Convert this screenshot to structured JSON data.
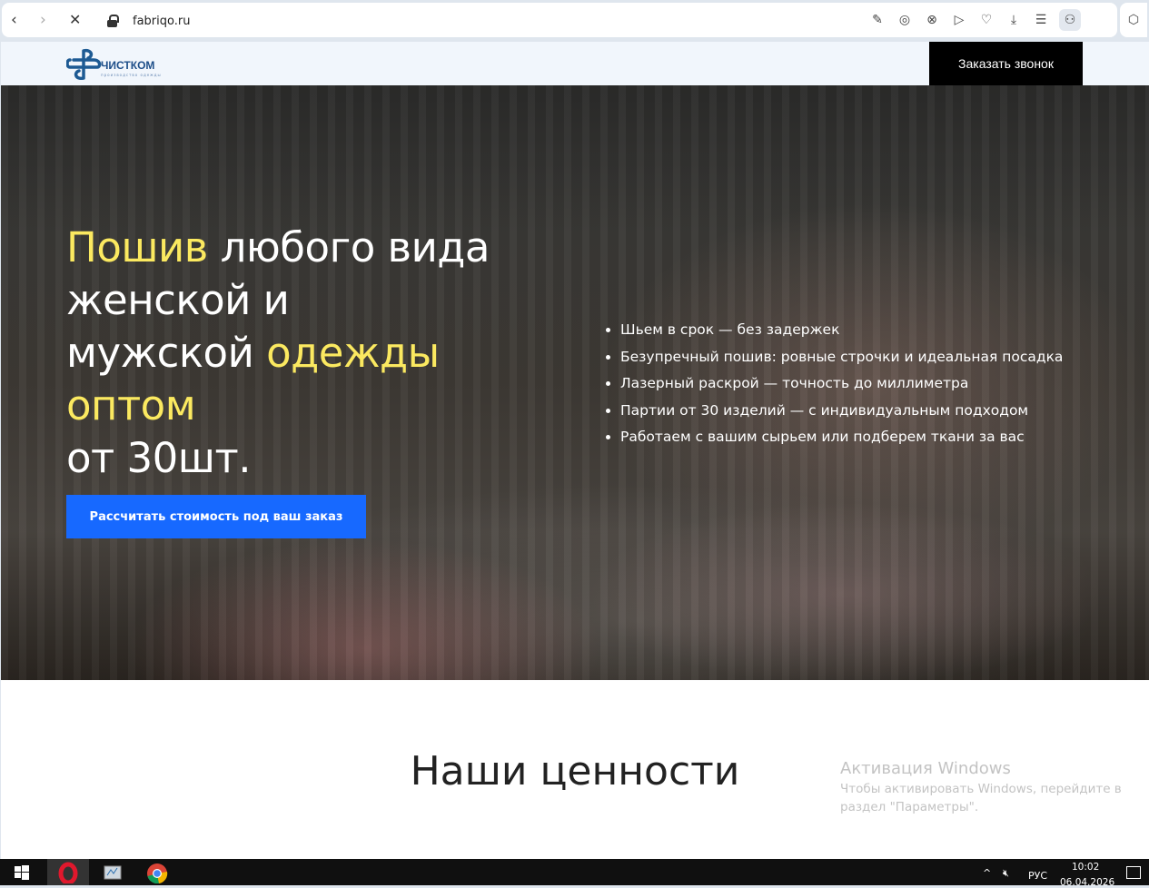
{
  "browser": {
    "url": "fabriqo.ru",
    "back": "‹",
    "forward": "›",
    "stop": "✕",
    "toolbar_icons": [
      "edit-icon",
      "camera-icon",
      "shield-x-icon",
      "send-icon",
      "heart-icon",
      "download-icon",
      "menu-icon",
      "profile-icon"
    ]
  },
  "header": {
    "logo_text": "ЧИСТКОМ",
    "logo_sub": "производство одежды",
    "call_button": "Заказать звонок"
  },
  "hero": {
    "title_parts": [
      "Пошив",
      "любого вида",
      "женской и",
      "мужской",
      "одежды оптом",
      "от 30шт."
    ],
    "bullets": [
      "Шьем в срок — без задержек",
      "Безупречный пошив: ровные строчки и идеальная посадка",
      "Лазерный раскрой — точность до миллиметра",
      "Партии от 30 изделий — с индивидуальным подходом",
      "Работаем с вашим сырьем или подберем ткани за вас"
    ],
    "cta": "Рассчитать стоимость под ваш заказ",
    "accent": "#fbe960",
    "button_color": "#1769ff"
  },
  "values": {
    "title": "Наши ценности"
  },
  "watermark": {
    "title": "Активация Windows",
    "text1": "Чтобы активировать Windows, перейдите в",
    "text2": "раздел \"Параметры\"."
  },
  "taskbar": {
    "lang": "РУС",
    "time": "10:02",
    "date": "06.04.2026"
  }
}
